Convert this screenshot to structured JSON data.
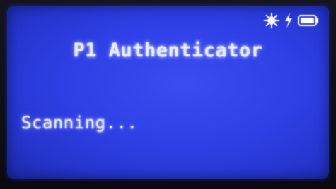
{
  "screen": {
    "title": "P1 Authenticator",
    "status_text": "Scanning...",
    "background_color": "#2f40e6",
    "text_color": "#e8ecff"
  },
  "status_bar": {
    "icons": [
      "bluetooth-activity-icon",
      "charging-icon",
      "battery-icon"
    ]
  }
}
